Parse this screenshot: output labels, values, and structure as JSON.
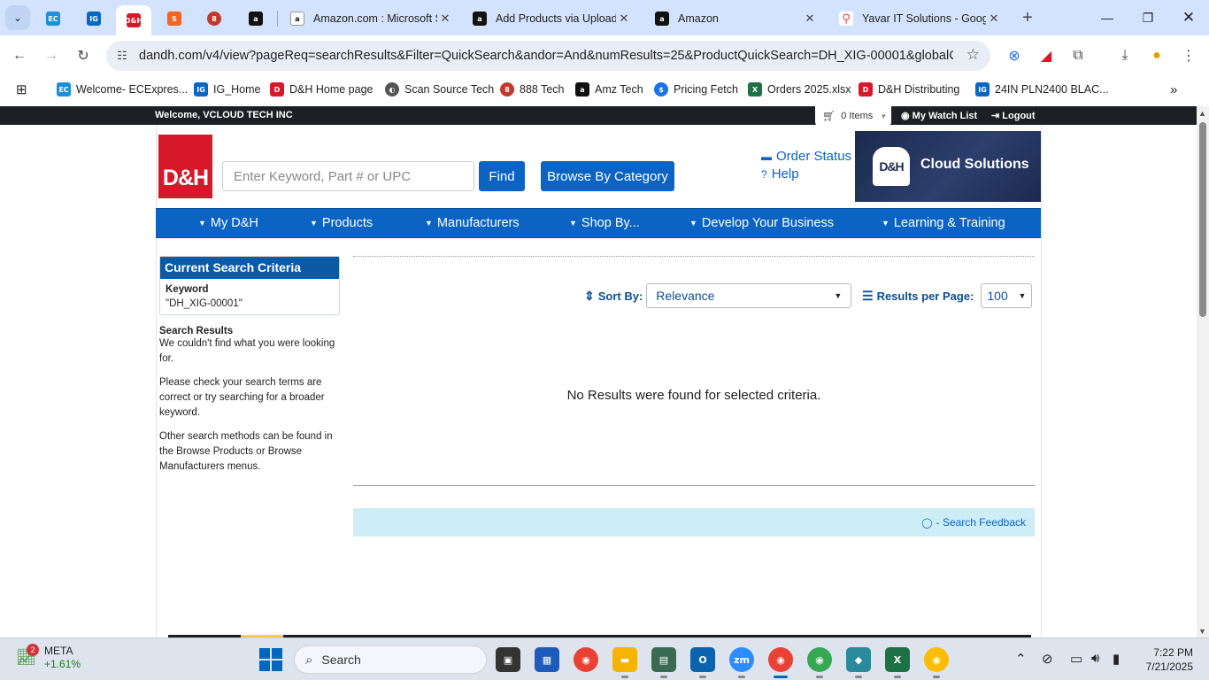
{
  "browser": {
    "tabs": [
      {
        "title": "Amazon.com : Microsoft S",
        "icon": "amazon-icon"
      },
      {
        "title": "Add Products via Upload:",
        "icon": "amazon-icon"
      },
      {
        "title": "Amazon",
        "icon": "amazon-icon"
      },
      {
        "title": "Yavar IT Solutions - Goog",
        "icon": "maps-icon"
      }
    ],
    "pinned_tabs": [
      "EC",
      "IG",
      "D&H",
      "S",
      "8",
      "a"
    ],
    "url": "dandh.com/v4/view?pageReq=searchResults&Filter=QuickSearch&andor=And&numResults=25&ProductQuickSearch=DH_XIG-00001&globalCSP...",
    "bookmarks": [
      {
        "label": "Welcome- ECExpres...",
        "icon": "ec-icon"
      },
      {
        "label": "IG_Home",
        "icon": "ig-icon"
      },
      {
        "label": "D&H Home page",
        "icon": "dh-icon"
      },
      {
        "label": "Scan Source Tech",
        "icon": "globe-icon"
      },
      {
        "label": "888 Tech",
        "icon": "888-icon"
      },
      {
        "label": "Amz Tech",
        "icon": "amazon-icon"
      },
      {
        "label": "Pricing Fetch",
        "icon": "dollar-icon"
      },
      {
        "label": "Orders 2025.xlsx",
        "icon": "excel-icon"
      },
      {
        "label": "D&H Distributing",
        "icon": "dh-icon"
      },
      {
        "label": "24IN PLN2400 BLAC...",
        "icon": "ig-icon"
      }
    ]
  },
  "header": {
    "welcome": "Welcome, VCLOUD TECH INC",
    "cart": "0 Items",
    "watch_list": "My Watch List",
    "logout": "Logout",
    "logo_text": "D&H",
    "search_placeholder": "Enter Keyword, Part # or UPC",
    "find_label": "Find",
    "browse_label": "Browse By Category",
    "order_status": "Order Status",
    "help": "Help",
    "banner_logo": "D&H",
    "banner_text": "Cloud Solutions"
  },
  "nav": [
    "My D&H",
    "Products",
    "Manufacturers",
    "Shop By...",
    "Develop Your Business",
    "Learning & Training"
  ],
  "sidebar": {
    "criteria_title": "Current Search Criteria",
    "keyword_label": "Keyword",
    "keyword_value": "\"DH_XIG-00001\"",
    "results_title": "Search Results",
    "msg1": "We couldn't find what you were looking for.",
    "msg2": "Please check your search terms are correct or try searching for a broader keyword.",
    "msg3": "Other search methods can be found in the Browse Products or Browse Manufacturers menus."
  },
  "results": {
    "sort_label": "Sort By:",
    "sort_value": "Relevance",
    "rpp_label": "Results per Page:",
    "rpp_value": "100",
    "no_results": "No Results were found for selected criteria.",
    "feedback": "- Search Feedback"
  },
  "taskbar": {
    "stock_name": "META",
    "stock_change": "+1.61%",
    "stock_badge": "2",
    "search_label": "Search",
    "time": "7:22 PM",
    "date": "7/21/2025"
  }
}
